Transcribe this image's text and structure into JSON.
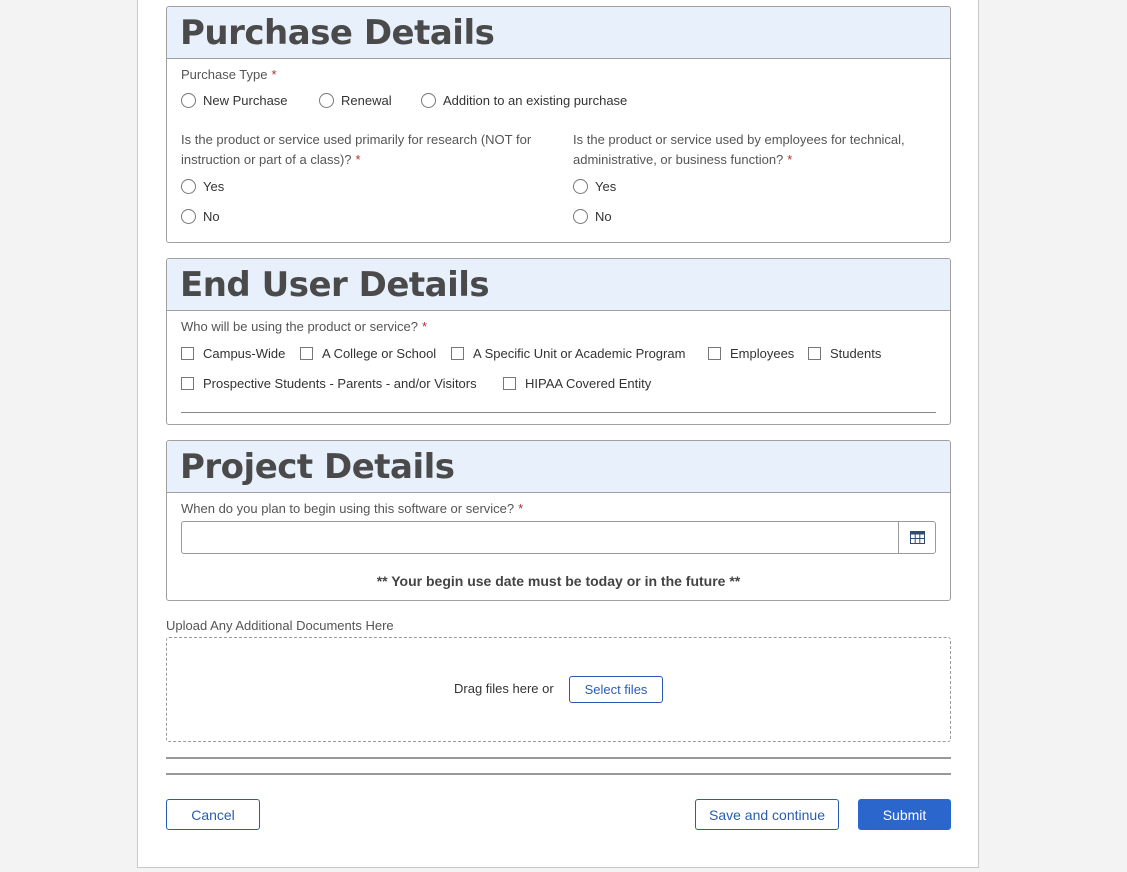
{
  "purchase": {
    "title": "Purchase Details",
    "type_label": "Purchase Type",
    "type_options": [
      "New Purchase",
      "Renewal",
      "Addition to an existing purchase"
    ],
    "research_question": "Is the product or service used primarily for research (NOT for instruction or part of a class)?",
    "employee_question": "Is the product or service used by employees for technical, administrative, or business function?",
    "yes": "Yes",
    "no": "No"
  },
  "end_user": {
    "title": "End User Details",
    "question": "Who will be using the product or service?",
    "options": [
      "Campus-Wide",
      "A College or School",
      "A Specific Unit or Academic Program",
      "Employees",
      "Students",
      "Prospective Students - Parents - and/or Visitors",
      "HIPAA Covered Entity"
    ]
  },
  "project": {
    "title": "Project Details",
    "question": "When do you plan to begin using this software or service?",
    "date_value": "",
    "note": "** Your begin use date must be today or in the future **"
  },
  "upload": {
    "label": "Upload Any Additional Documents Here",
    "drag_text": "Drag files here or",
    "select_label": "Select files"
  },
  "actions": {
    "cancel": "Cancel",
    "save": "Save and continue",
    "submit": "Submit"
  },
  "required_mark": "*",
  "icons": {
    "calendar": "calendar-icon"
  },
  "colors": {
    "accent": "#2a66cc",
    "section_header_bg": "#e8f0fb",
    "required": "#b03030"
  }
}
